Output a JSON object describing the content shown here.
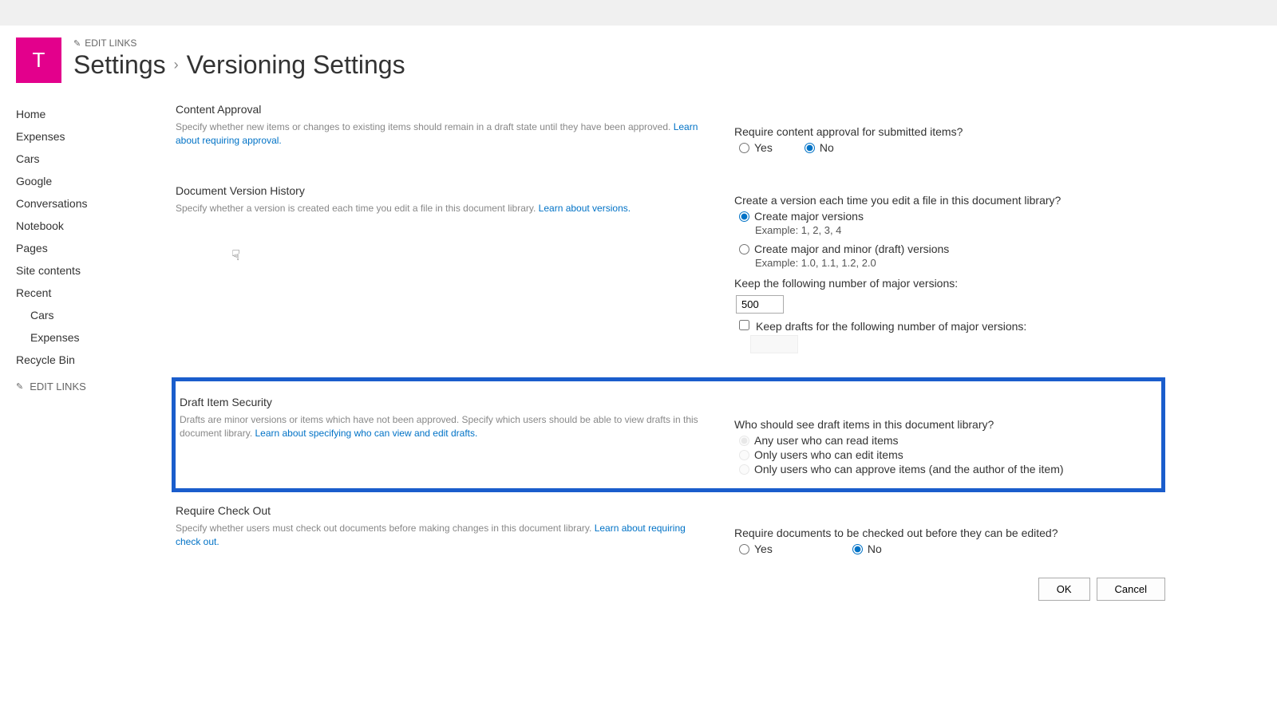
{
  "header": {
    "logo_letter": "T",
    "edit_links": "EDIT LINKS",
    "breadcrumb_root": "Settings",
    "breadcrumb_sep": "›",
    "breadcrumb_current": "Versioning Settings"
  },
  "sidebar": {
    "items": [
      "Home",
      "Expenses",
      "Cars",
      "Google",
      "Conversations",
      "Notebook",
      "Pages",
      "Site contents",
      "Recent"
    ],
    "recent_items": [
      "Cars",
      "Expenses"
    ],
    "recycle": "Recycle Bin",
    "edit_links": "EDIT LINKS"
  },
  "sections": {
    "content_approval": {
      "title": "Content Approval",
      "desc": "Specify whether new items or changes to existing items should remain in a draft state until they have been approved.  ",
      "link": "Learn about requiring approval.",
      "question": "Require content approval for submitted items?",
      "yes": "Yes",
      "no": "No"
    },
    "version_history": {
      "title": "Document Version History",
      "desc": "Specify whether a version is created each time you edit a file in this document library.  ",
      "link": "Learn about versions.",
      "question": "Create a version each time you edit a file in this document library?",
      "opt_major": "Create major versions",
      "ex_major": "Example: 1, 2, 3, 4",
      "opt_minor": "Create major and minor (draft) versions",
      "ex_minor": "Example: 1.0, 1.1, 1.2, 2.0",
      "keep_label": "Keep the following number of major versions:",
      "keep_value": "500",
      "keep_drafts": "Keep drafts for the following number of major versions:"
    },
    "draft_security": {
      "title": "Draft Item Security",
      "desc": "Drafts are minor versions or items which have not been approved. Specify which users should be able to view drafts in this document library.   ",
      "link": "Learn about specifying who can view and edit drafts.",
      "question": "Who should see draft items in this document library?",
      "opt1": "Any user who can read items",
      "opt2": "Only users who can edit items",
      "opt3": "Only users who can approve items (and the author of the item)"
    },
    "checkout": {
      "title": "Require Check Out",
      "desc": "Specify whether users must check out documents before making changes in this document library.  ",
      "link": "Learn about requiring check out.",
      "question": "Require documents to be checked out before they can be edited?",
      "yes": "Yes",
      "no": "No"
    }
  },
  "buttons": {
    "ok": "OK",
    "cancel": "Cancel"
  }
}
